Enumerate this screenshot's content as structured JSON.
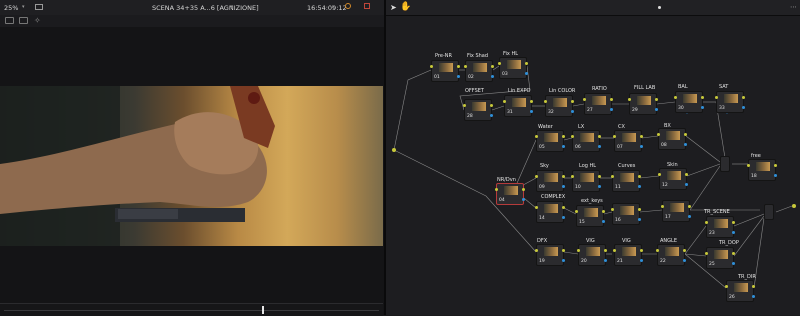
{
  "viewer": {
    "zoom": "25%",
    "clip_name": "SCENA 34+35 A...6 [AGNIZIONE]",
    "timecode": "16:54:09:12"
  },
  "node_graph": {
    "nodes": [
      {
        "id": "prenr",
        "label": "Pre-NR",
        "num": "01"
      },
      {
        "id": "fixshad",
        "label": "Fix Shad",
        "num": "02"
      },
      {
        "id": "fixhl",
        "label": "Fix HL",
        "num": "03"
      },
      {
        "id": "offset",
        "label": "OFFSET",
        "num": "28"
      },
      {
        "id": "linexpo",
        "label": "Lin EXPO",
        "num": "31"
      },
      {
        "id": "lincolor",
        "label": "Lin COLOR",
        "num": "32"
      },
      {
        "id": "ratio",
        "label": "RATIO",
        "num": "27"
      },
      {
        "id": "filllab",
        "label": "FILL LAB",
        "num": "29"
      },
      {
        "id": "bal",
        "label": "BAL",
        "num": "30"
      },
      {
        "id": "sat",
        "label": "SAT",
        "num": "33"
      },
      {
        "id": "water",
        "label": "Water",
        "num": "05"
      },
      {
        "id": "lx",
        "label": "LX",
        "num": "06"
      },
      {
        "id": "cx",
        "label": "CX",
        "num": "07"
      },
      {
        "id": "bx",
        "label": "BX",
        "num": "08"
      },
      {
        "id": "nrdvn",
        "label": "NR/Dvn",
        "num": "04"
      },
      {
        "id": "sky",
        "label": "Sky",
        "num": "09"
      },
      {
        "id": "loghl",
        "label": "Log HL",
        "num": "10"
      },
      {
        "id": "curves",
        "label": "Curves",
        "num": "11"
      },
      {
        "id": "skin",
        "label": "Skin",
        "num": "12"
      },
      {
        "id": "free",
        "label": "free",
        "num": "18"
      },
      {
        "id": "complex",
        "label": "COMPLEX",
        "num": "14"
      },
      {
        "id": "extkeys",
        "label": "ext_keys",
        "num": "15"
      },
      {
        "id": "n16",
        "label": "",
        "num": "16"
      },
      {
        "id": "n17",
        "label": "",
        "num": "17"
      },
      {
        "id": "trscene",
        "label": "TR_SCENE",
        "num": "23"
      },
      {
        "id": "dfx",
        "label": "DFX",
        "num": "19"
      },
      {
        "id": "vig1",
        "label": "VIG",
        "num": "20"
      },
      {
        "id": "vig2",
        "label": "VIG",
        "num": "21"
      },
      {
        "id": "angle",
        "label": "ANGLE",
        "num": "22"
      },
      {
        "id": "trdop",
        "label": "TR_DOP",
        "num": "25"
      },
      {
        "id": "trdir",
        "label": "TR_DIR",
        "num": "26"
      }
    ]
  },
  "icons": {
    "pointer": "pointer-icon",
    "hand": "hand-icon"
  }
}
